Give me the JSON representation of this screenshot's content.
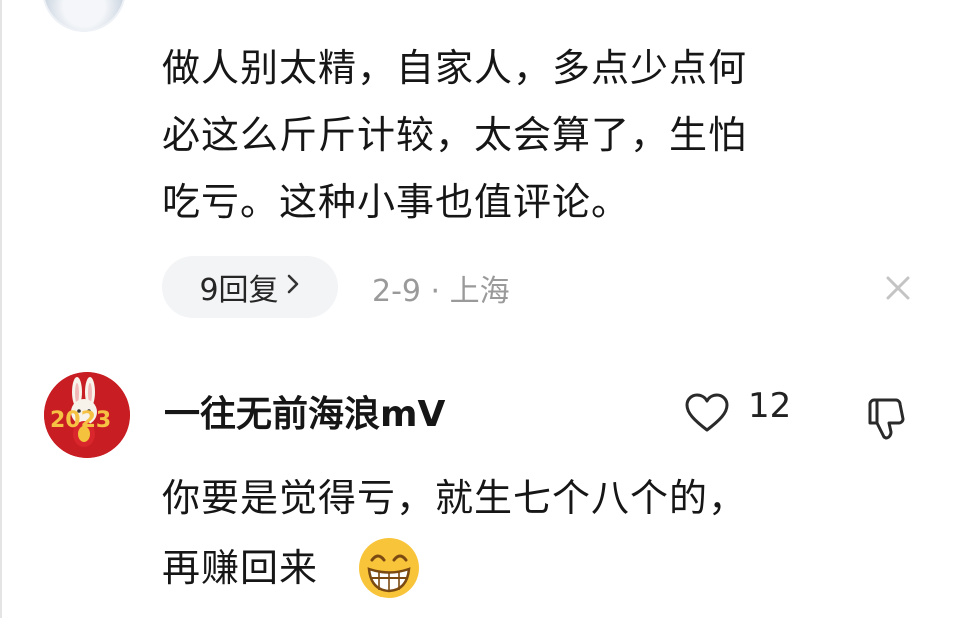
{
  "comments": [
    {
      "text_lines": [
        "做人别太精，自家人，多点少点何",
        "必这么斤斤计较，太会算了，生怕",
        "吃亏。这种小事也值评论。"
      ],
      "replies_label": "9回复",
      "date": "2-9",
      "location": "上海"
    },
    {
      "username": "一往无前海浪mV",
      "avatar_text": "2023",
      "likes": "12",
      "text_lines": [
        "你要是觉得亏，就生七个八个的，",
        "再赚回来"
      ],
      "emoji": "grinning-face-emoji"
    }
  ],
  "icons": {
    "reply_chevron": "chevron-right-icon",
    "close": "close-icon",
    "like": "heart-icon",
    "dislike": "thumbs-down-icon"
  },
  "colors": {
    "text": "#161616",
    "meta": "#9a9a9a",
    "pill_bg": "#f3f4f6",
    "avatar_red": "#c81d22",
    "emoji_yellow": "#f8c43a"
  }
}
